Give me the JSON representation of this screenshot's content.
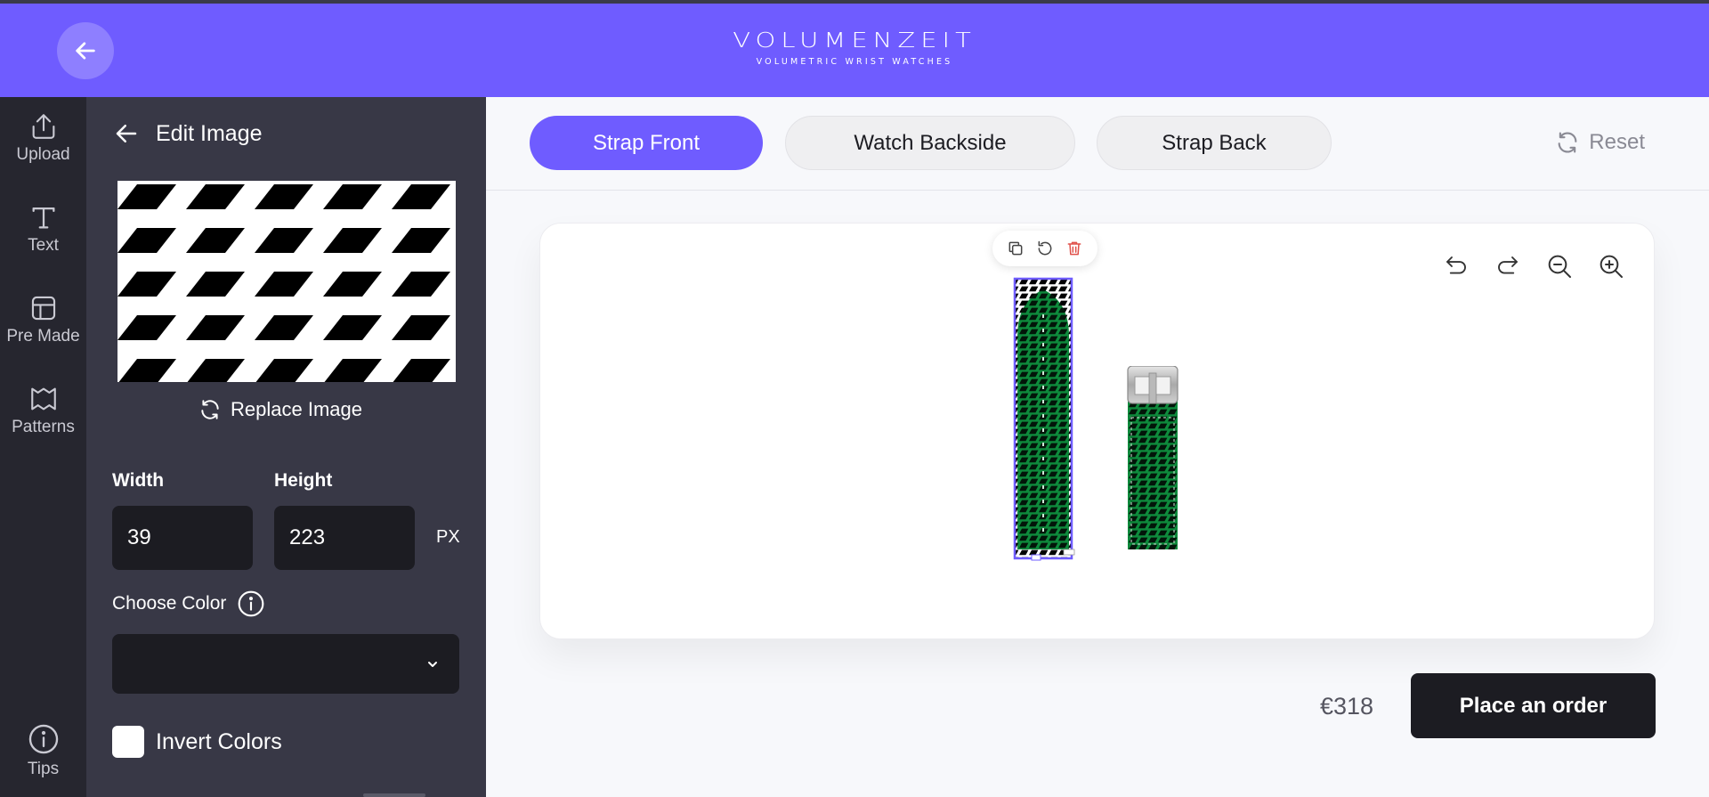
{
  "header": {
    "brand": "VOLUMENZEIT",
    "tagline": "VOLUMETRIC WRIST WATCHES",
    "colors": {
      "brand_purple": "#6f5cff",
      "dark": "#1c1c22"
    },
    "back_icon": "arrow-left-icon"
  },
  "rail": {
    "items": [
      {
        "label": "Upload",
        "icon": "upload-icon"
      },
      {
        "label": "Text",
        "icon": "text-icon"
      },
      {
        "label": "Pre Made",
        "icon": "layout-icon"
      },
      {
        "label": "Patterns",
        "icon": "pattern-icon"
      }
    ],
    "tips": {
      "label": "Tips",
      "icon": "info-icon"
    }
  },
  "panel": {
    "title": "Edit Image",
    "replace_label": "Replace Image",
    "width_label": "Width",
    "height_label": "Height",
    "width_value": "39",
    "height_value": "223",
    "unit": "PX",
    "choose_color_label": "Choose Color",
    "invert_label": "Invert Colors",
    "invert_checked": false
  },
  "tabs": [
    {
      "label": "Strap Front",
      "active": true
    },
    {
      "label": "Watch Backside",
      "active": false
    },
    {
      "label": "Strap Back",
      "active": false
    }
  ],
  "reset_label": "Reset",
  "canvas": {
    "tools": [
      "undo-icon",
      "redo-icon",
      "zoom-out-icon",
      "zoom-in-icon"
    ],
    "selection_tools": [
      "duplicate-icon",
      "rotate-icon",
      "delete-icon"
    ],
    "strap_color": "#0e8a3c"
  },
  "order": {
    "price": "€318",
    "button_label": "Place an order"
  }
}
